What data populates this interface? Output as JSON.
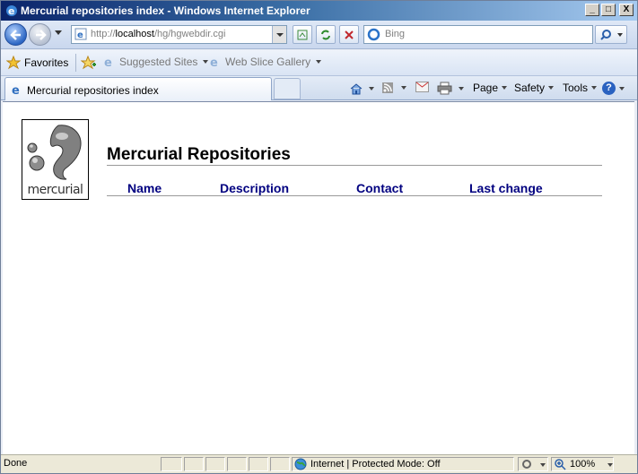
{
  "window": {
    "title": "Mercurial repositories index - Windows Internet Explorer",
    "minimize": "_",
    "maximize": "□",
    "close": "X"
  },
  "address": {
    "url_prefix": "http://",
    "url_host": "localhost",
    "url_path": "/hg/hgwebdir.cgi"
  },
  "search": {
    "placeholder": "Bing"
  },
  "favorites": {
    "label": "Favorites",
    "suggested": "Suggested Sites",
    "gallery": "Web Slice Gallery"
  },
  "tabs": [
    {
      "label": "Mercurial repositories index"
    }
  ],
  "commands": {
    "page": "Page",
    "safety": "Safety",
    "tools": "Tools",
    "help": "?"
  },
  "page": {
    "logo_text": "mercurial",
    "title": "Mercurial Repositories",
    "columns": [
      "Name",
      "Description",
      "Contact",
      "Last change"
    ]
  },
  "status": {
    "left": "Done",
    "zone": "Internet | Protected Mode: Off",
    "zoom": "100%"
  },
  "colors": {
    "column_header": "#000080",
    "titlebar_start": "#0a246a"
  }
}
